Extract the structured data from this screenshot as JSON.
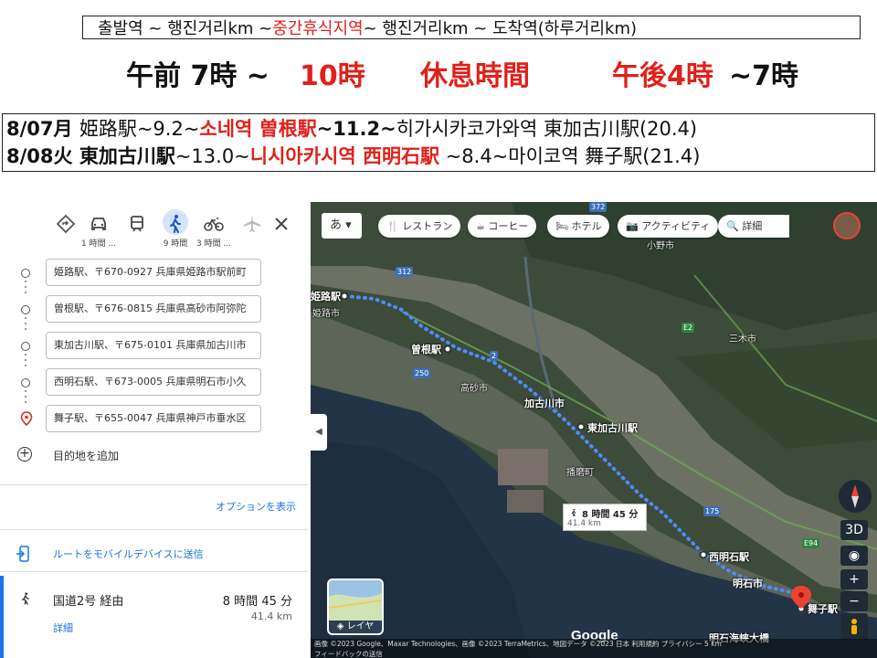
{
  "header": {
    "legend_a": "출발역 ~ 행진거리km ~ ",
    "legend_b": "중간휴식지역",
    "legend_c": " ~ 행진거리km ~ 도착역(하루거리km)",
    "time_start": "午前 7時 ~ ",
    "time_mid": "10時",
    "time_rest": "休息時間",
    "time_pm": "午後4時",
    "time_end": "~7時"
  },
  "plan": [
    {
      "date": "8/07月 ",
      "from": "姫路駅",
      "d1": "~9.2~",
      "mid": "소네역 曽根駅",
      "d2": "~11.2~",
      "to": "히가시카코가와역 東加古川駅",
      "total": "(20.4)"
    },
    {
      "date": "8/08火 ",
      "from": "東加古川駅",
      "d1": "~13.0~",
      "mid": "니시아카시역 西明石駅",
      "d2": " ~8.4~",
      "to": "마이코역 舞子駅",
      "total": "(21.4)"
    }
  ],
  "modes": [
    {
      "name": "best",
      "time": ""
    },
    {
      "name": "car",
      "time": "1 時間 ..."
    },
    {
      "name": "transit",
      "time": ""
    },
    {
      "name": "walk",
      "time": "9 時間"
    },
    {
      "name": "bike",
      "time": "3 時間 ..."
    },
    {
      "name": "flight",
      "time": ""
    }
  ],
  "stops": [
    "姫路駅、〒670-0927 兵庫県姫路市駅前町",
    "曽根駅、〒676-0815 兵庫県高砂市阿弥陀",
    "東加古川駅、〒675-0101 兵庫県加古川市",
    "西明石駅、〒673-0005 兵庫県明石市小久",
    "舞子駅、〒655-0047 兵庫県神戸市垂水区"
  ],
  "add_destination": "目的地を追加",
  "options_label": "オプションを表示",
  "send_label": "ルートをモバイルデバイスに送信",
  "route": {
    "via": "国道2号 経由",
    "time": "8 時間 45 分",
    "distance": "41.4 km",
    "details": "詳細"
  },
  "map": {
    "ime": "あ",
    "chips": [
      "レストラン",
      "コーヒー",
      "ホテル",
      "アクティビティ",
      "詳細"
    ],
    "places": {
      "himeji": "姫路駅",
      "himeji_city": "姫路市",
      "sone": "曽根駅",
      "takasago": "高砂市",
      "kakogawa_city": "加古川市",
      "higashikakogawa": "東加古川駅",
      "harima": "播磨町",
      "nishiakashi": "西明石駅",
      "akashi": "明石市",
      "maiko": "舞子駅",
      "bridge": "明石海峡大橋",
      "ono": "小野市",
      "miki": "三木市"
    },
    "walk_time": "8 時間 45 分",
    "walk_dist": "41.4 km",
    "layer_label": "レイヤ",
    "btn_3d": "3D",
    "btn_plus": "+",
    "btn_minus": "−",
    "google": "Google",
    "footer": "画像 ©2023 Google、Maxar Technologies、画像 ©2023 TerraMetrics、地図データ ©2023    日本    利用規約    プライバシー    5 km",
    "footer2": "フィードバックの送信",
    "road_badges": [
      "372",
      "312",
      "250",
      "175",
      "E94",
      "E2",
      "2"
    ]
  }
}
